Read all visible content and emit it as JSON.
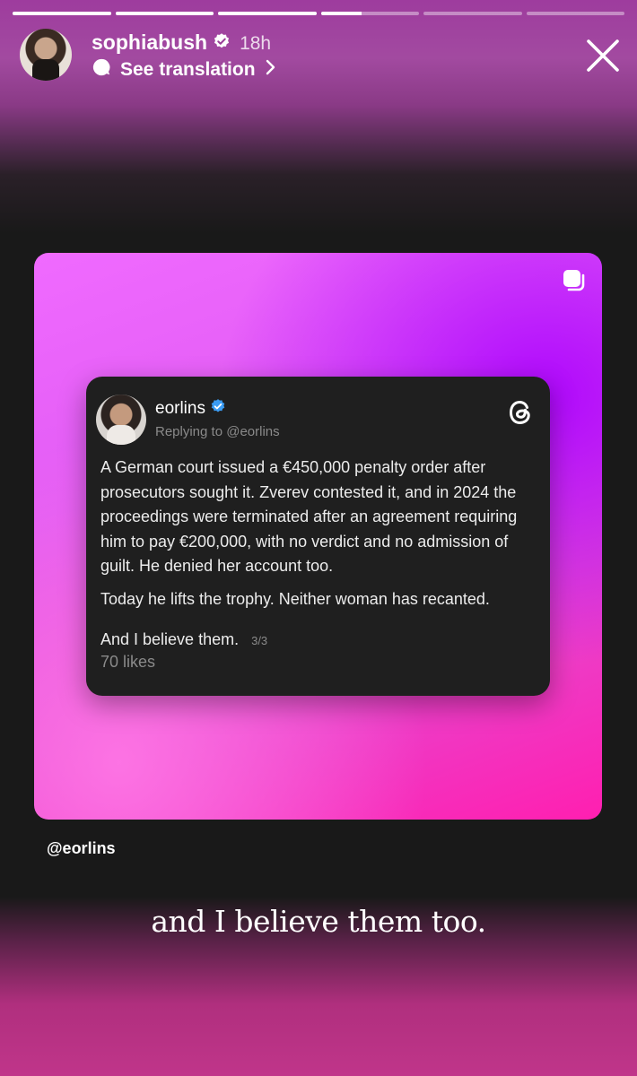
{
  "story": {
    "segments": [
      1,
      1,
      1,
      0.42,
      0,
      0
    ]
  },
  "header": {
    "username": "sophiabush",
    "time": "18h",
    "translation_label": "See translation"
  },
  "post": {
    "username": "eorlins",
    "reply_label": "Replying to @eorlins",
    "paragraphs": [
      "A German court issued a €450,000 penalty order after prosecutors sought it. Zverev contested it, and in 2024 the proceedings were terminated after an agreement requiring him to pay €200,000, with no verdict and no admission of guilt. He denied her account too.",
      "Today he lifts the trophy. Neither woman has recanted."
    ],
    "last_line": "And I believe them.",
    "page_indicator": "3/3",
    "likes": "70 likes"
  },
  "mention": "@eorlins",
  "caption": "and I believe them too.",
  "colors": {
    "verified_badge": "#3b9cf3",
    "card_start": "#f06aff",
    "card_end": "#ff1fb0"
  }
}
